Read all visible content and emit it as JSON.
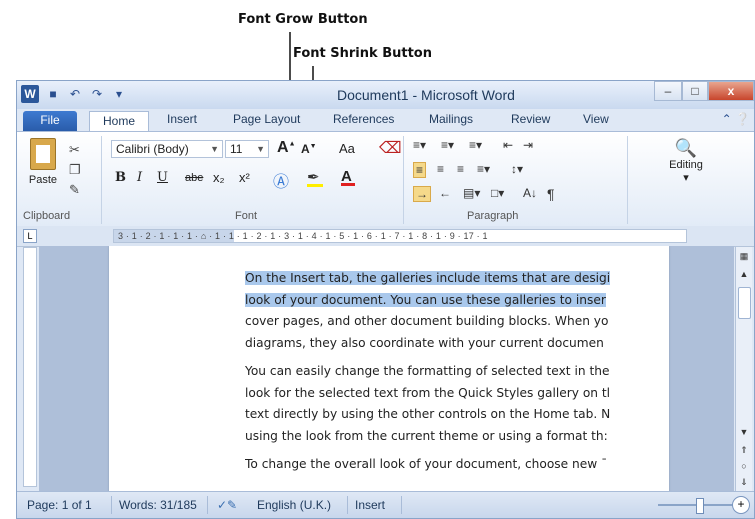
{
  "annotations": {
    "grow": "Font Grow Button",
    "shrink": "Font Shrink Button"
  },
  "window": {
    "title": "Document1 - Microsoft Word",
    "app_icon": "W",
    "controls": {
      "minimize": "–",
      "maximize": "□",
      "close": "x"
    }
  },
  "tabs": [
    "File",
    "Home",
    "Insert",
    "Page Layout",
    "References",
    "Mailings",
    "Review",
    "View"
  ],
  "ribbon": {
    "clipboard": {
      "paste": "Paste",
      "group": "Clipboard"
    },
    "font": {
      "family": "Calibri (Body)",
      "size": "11",
      "grow": "A",
      "shrink": "A",
      "change_case": "Aa",
      "bold": "B",
      "italic": "I",
      "underline": "U",
      "strike": "abe",
      "subscript": "x₂",
      "superscript": "x²",
      "group": "Font"
    },
    "paragraph": {
      "group": "Paragraph",
      "sort": "A↓",
      "pilcrow": "¶"
    },
    "editing": {
      "label": "Editing"
    }
  },
  "ruler": "3 · 1 · 2 · 1 · 1 · 1 · ⌂ · 1 · 1 · 1 · 2 · 1 · 3 · 1 · 4 · 1 · 5 · 1 · 6 · 1 · 7 · 1 · 8 · 1 · 9 · 17 · 1",
  "document": {
    "para1": [
      "On the Insert tab, the galleries include items that are desigi",
      "look of your document. You can use these galleries to inser",
      "cover pages, and other document building blocks. When yo",
      "diagrams, they also coordinate with your current documen"
    ],
    "para2": [
      "You can easily change the formatting of selected text in the",
      "look for the selected text from the Quick Styles gallery on tl",
      "text directly by using the other controls on the Home tab. N",
      "using the look from the current theme or using a format th:"
    ],
    "para3": [
      "To change the overall look of your document, choose new ˉ"
    ],
    "selected_lines": 2
  },
  "status": {
    "page": "Page: 1 of 1",
    "words": "Words: 31/185",
    "language": "English (U.K.)",
    "mode": "Insert"
  }
}
